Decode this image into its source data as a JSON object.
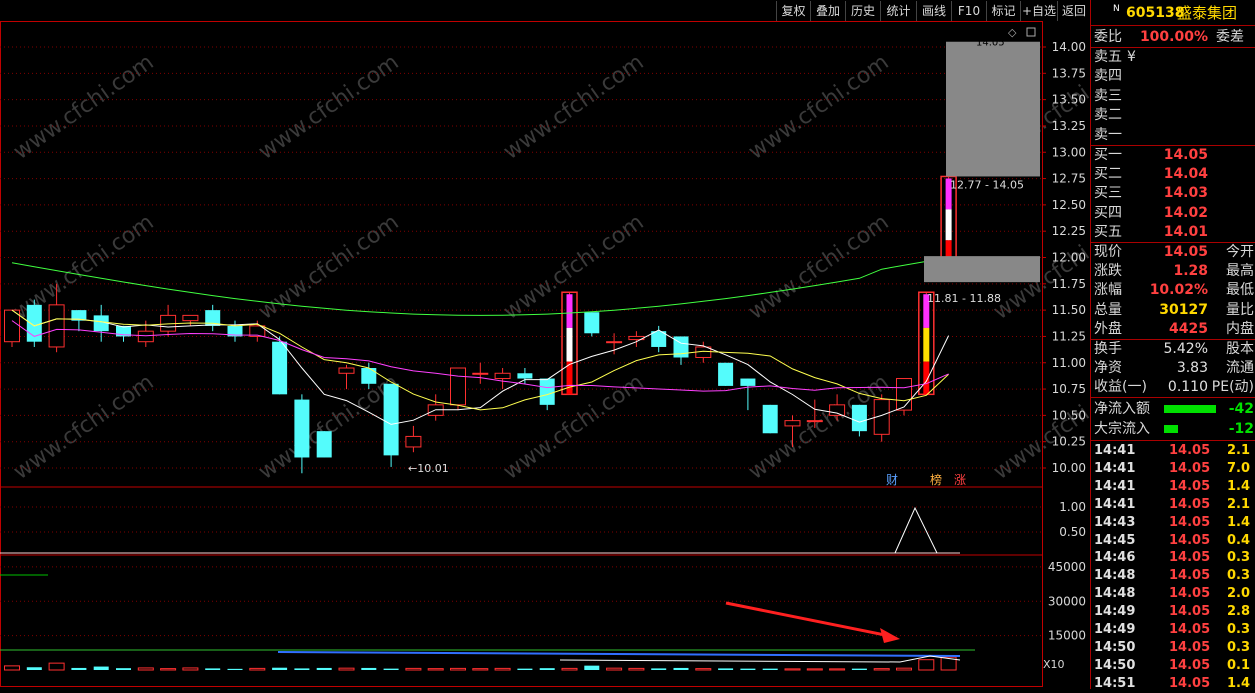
{
  "toolbar": {
    "buttons": [
      "复权",
      "叠加",
      "历史",
      "统计",
      "画线",
      "F10",
      "标记",
      "+自选",
      "返回"
    ]
  },
  "chart": {
    "price_ticks": [
      "14.00",
      "13.75",
      "13.50",
      "13.25",
      "13.00",
      "12.75",
      "12.50",
      "12.25",
      "12.00",
      "11.75",
      "11.50",
      "11.25",
      "11.00",
      "10.75",
      "10.50",
      "10.25",
      "10.00"
    ],
    "ind_ticks": [
      "1.00",
      "0.50"
    ],
    "vol_ticks": [
      "45000",
      "30000",
      "15000"
    ],
    "vol_unit": "X10",
    "low_mark": "←10.01",
    "high_mark": "14.05",
    "range_label_1": "12.77 - 14.05",
    "range_label_2": "11.81 - 11.88",
    "tag_cai": "财",
    "tag_bang": "榜",
    "tag_zhang": "涨",
    "watermark": "www.cfchi.com",
    "colors": {
      "up": "#ff3030",
      "down": "#54fcfc",
      "ma5": "#ffffff",
      "ma10": "#ffff50",
      "ma20": "#ff40ff",
      "ma60": "#40ff40",
      "grid": "#800000",
      "axis": "#c00000"
    }
  },
  "chart_data": {
    "type": "candlestick",
    "ylim": [
      9.85,
      14.1
    ],
    "candles": [
      {
        "o": 11.2,
        "c": 11.5,
        "h": 11.5,
        "l": 11.15
      },
      {
        "o": 11.55,
        "c": 11.2,
        "h": 11.6,
        "l": 11.15
      },
      {
        "o": 11.15,
        "c": 11.55,
        "h": 11.75,
        "l": 11.1
      },
      {
        "o": 11.5,
        "c": 11.4,
        "h": 11.5,
        "l": 11.3
      },
      {
        "o": 11.45,
        "c": 11.3,
        "h": 11.55,
        "l": 11.2
      },
      {
        "o": 11.35,
        "c": 11.25,
        "h": 11.35,
        "l": 11.2
      },
      {
        "o": 11.2,
        "c": 11.3,
        "h": 11.4,
        "l": 11.15
      },
      {
        "o": 11.3,
        "c": 11.45,
        "h": 11.55,
        "l": 11.25
      },
      {
        "o": 11.4,
        "c": 11.45,
        "h": 11.45,
        "l": 11.35
      },
      {
        "o": 11.5,
        "c": 11.35,
        "h": 11.55,
        "l": 11.3
      },
      {
        "o": 11.35,
        "c": 11.25,
        "h": 11.4,
        "l": 11.2
      },
      {
        "o": 11.25,
        "c": 11.35,
        "h": 11.4,
        "l": 11.2
      },
      {
        "o": 11.2,
        "c": 10.7,
        "h": 11.25,
        "l": 10.7
      },
      {
        "o": 10.65,
        "c": 10.1,
        "h": 10.7,
        "l": 9.95
      },
      {
        "o": 10.35,
        "c": 10.1,
        "h": 10.35,
        "l": 10.1
      },
      {
        "o": 10.9,
        "c": 10.95,
        "h": 10.98,
        "l": 10.75
      },
      {
        "o": 10.95,
        "c": 10.8,
        "h": 11.0,
        "l": 10.75
      },
      {
        "o": 10.8,
        "c": 10.12,
        "h": 10.8,
        "l": 10.01
      },
      {
        "o": 10.2,
        "c": 10.3,
        "h": 10.4,
        "l": 10.15
      },
      {
        "o": 10.5,
        "c": 10.6,
        "h": 10.7,
        "l": 10.45
      },
      {
        "o": 10.6,
        "c": 10.95,
        "h": 10.95,
        "l": 10.55
      },
      {
        "o": 10.9,
        "c": 10.9,
        "h": 11.0,
        "l": 10.8
      },
      {
        "o": 10.85,
        "c": 10.9,
        "h": 10.95,
        "l": 10.75
      },
      {
        "o": 10.9,
        "c": 10.85,
        "h": 10.95,
        "l": 10.8
      },
      {
        "o": 10.85,
        "c": 10.6,
        "h": 10.85,
        "l": 10.55
      },
      {
        "o": 10.7,
        "c": 11.67,
        "h": 11.67,
        "l": 10.7
      },
      {
        "o": 11.48,
        "c": 11.28,
        "h": 11.48,
        "l": 11.25
      },
      {
        "o": 11.2,
        "c": 11.2,
        "h": 11.28,
        "l": 11.08
      },
      {
        "o": 11.22,
        "c": 11.25,
        "h": 11.3,
        "l": 11.15
      },
      {
        "o": 11.3,
        "c": 11.15,
        "h": 11.35,
        "l": 11.1
      },
      {
        "o": 11.25,
        "c": 11.05,
        "h": 11.25,
        "l": 10.98
      },
      {
        "o": 11.05,
        "c": 11.15,
        "h": 11.2,
        "l": 11.0
      },
      {
        "o": 11.0,
        "c": 10.78,
        "h": 11.0,
        "l": 10.78
      },
      {
        "o": 10.85,
        "c": 10.78,
        "h": 10.85,
        "l": 10.55
      },
      {
        "o": 10.6,
        "c": 10.33,
        "h": 10.6,
        "l": 10.33
      },
      {
        "o": 10.4,
        "c": 10.45,
        "h": 10.5,
        "l": 10.2
      },
      {
        "o": 10.45,
        "c": 10.45,
        "h": 10.65,
        "l": 10.38
      },
      {
        "o": 10.5,
        "c": 10.6,
        "h": 10.7,
        "l": 10.45
      },
      {
        "o": 10.6,
        "c": 10.35,
        "h": 10.6,
        "l": 10.3
      },
      {
        "o": 10.32,
        "c": 10.65,
        "h": 10.7,
        "l": 10.25
      },
      {
        "o": 10.55,
        "c": 10.85,
        "h": 10.85,
        "l": 10.5
      },
      {
        "o": 10.7,
        "c": 11.67,
        "h": 11.67,
        "l": 10.7
      },
      {
        "o": 11.88,
        "c": 12.77,
        "h": 12.77,
        "l": 11.81
      }
    ],
    "volumes": [
      1800,
      1200,
      3000,
      900,
      1500,
      800,
      900,
      600,
      900,
      700,
      500,
      700,
      1000,
      700,
      900,
      800,
      900,
      600,
      700,
      600,
      700,
      600,
      700,
      600,
      800,
      700,
      1900,
      800,
      700,
      700,
      900,
      600,
      700,
      600,
      600,
      500,
      500,
      500,
      600,
      600,
      800,
      4500,
      5600
    ]
  },
  "panel": {
    "code": "605138",
    "name": "盛泰集团",
    "n_badge": "N",
    "weibi_label": "委比",
    "weibi_val": "100.00%",
    "weicha_label": "委差",
    "sell": [
      {
        "label": "卖五",
        "price": "¥"
      },
      {
        "label": "卖四",
        "price": ""
      },
      {
        "label": "卖三",
        "price": ""
      },
      {
        "label": "卖二",
        "price": ""
      },
      {
        "label": "卖一",
        "price": ""
      }
    ],
    "buy": [
      {
        "label": "买一",
        "price": "14.05"
      },
      {
        "label": "买二",
        "price": "14.04"
      },
      {
        "label": "买三",
        "price": "14.03"
      },
      {
        "label": "买四",
        "price": "14.02"
      },
      {
        "label": "买五",
        "price": "14.01"
      }
    ],
    "stats": [
      {
        "label": "现价",
        "value": "14.05",
        "label2": "今开"
      },
      {
        "label": "涨跌",
        "value": "1.28",
        "label2": "最高"
      },
      {
        "label": "涨幅",
        "value": "10.02%",
        "label2": "最低"
      },
      {
        "label": "总量",
        "value": "30127",
        "label2": "量比"
      },
      {
        "label": "外盘",
        "value": "4425",
        "label2": "内盘"
      }
    ],
    "stats2": [
      {
        "label": "换手",
        "value": "5.42%",
        "label2": "股本"
      },
      {
        "label": "净资",
        "value": "3.83",
        "label2": "流通"
      },
      {
        "label": "收益(一)",
        "value": "0.110",
        "label2": "PE(动)"
      }
    ],
    "flow": [
      {
        "label": "净流入额",
        "value": "-42"
      },
      {
        "label": "大宗流入",
        "value": "-12"
      }
    ],
    "ticks": [
      {
        "t": "14:41",
        "p": "14.05",
        "v": "2.1"
      },
      {
        "t": "14:41",
        "p": "14.05",
        "v": "7.0"
      },
      {
        "t": "14:41",
        "p": "14.05",
        "v": "1.4"
      },
      {
        "t": "14:41",
        "p": "14.05",
        "v": "2.1"
      },
      {
        "t": "14:43",
        "p": "14.05",
        "v": "1.4"
      },
      {
        "t": "14:45",
        "p": "14.05",
        "v": "0.4"
      },
      {
        "t": "14:46",
        "p": "14.05",
        "v": "0.3"
      },
      {
        "t": "14:48",
        "p": "14.05",
        "v": "0.3"
      },
      {
        "t": "14:48",
        "p": "14.05",
        "v": "2.0"
      },
      {
        "t": "14:49",
        "p": "14.05",
        "v": "2.8"
      },
      {
        "t": "14:49",
        "p": "14.05",
        "v": "0.3"
      },
      {
        "t": "14:50",
        "p": "14.05",
        "v": "0.3"
      },
      {
        "t": "14:50",
        "p": "14.05",
        "v": "0.1"
      },
      {
        "t": "14:51",
        "p": "14.05",
        "v": "1.4"
      }
    ]
  }
}
